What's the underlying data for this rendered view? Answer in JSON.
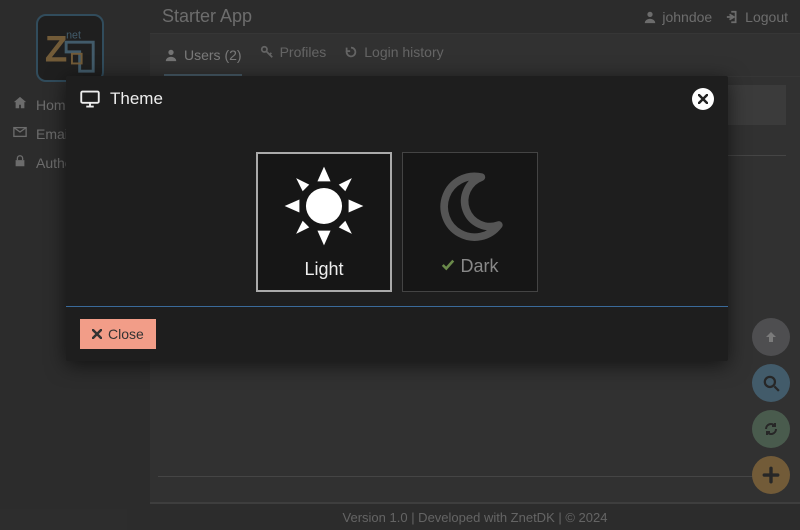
{
  "app": {
    "title": "Starter App"
  },
  "user": {
    "name": "johndoe",
    "logout_label": "Logout"
  },
  "sidebar": {
    "items": [
      {
        "label": "Home",
        "icon": "home"
      },
      {
        "label": "Email settings",
        "icon": "mail"
      },
      {
        "label": "Authorizations",
        "icon": "lock"
      }
    ]
  },
  "tabs": [
    {
      "label": "Users (2)",
      "icon": "user",
      "active": true
    },
    {
      "label": "Profiles",
      "icon": "key",
      "active": false
    },
    {
      "label": "Login history",
      "icon": "history",
      "active": false
    }
  ],
  "modal": {
    "title": "Theme",
    "options": [
      {
        "label": "Light",
        "selected": false
      },
      {
        "label": "Dark",
        "selected": true
      }
    ],
    "close_label": "Close"
  },
  "fabs": {
    "up": "Scroll to top",
    "search": "Search",
    "refresh": "Refresh",
    "add": "Add"
  },
  "footer": {
    "text": "Version 1.0 | Developed with ZnetDK | © 2024"
  }
}
